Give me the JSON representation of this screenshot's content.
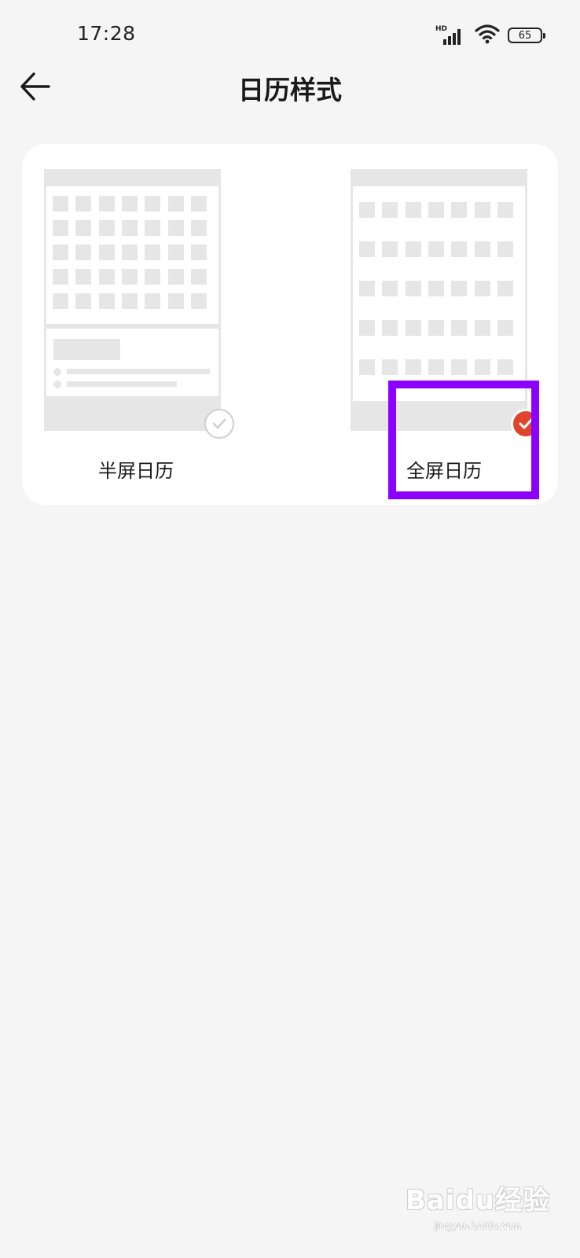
{
  "status_bar": {
    "time": "17:28",
    "network_label": "HD",
    "battery_level": "65"
  },
  "header": {
    "title": "日历样式",
    "back_icon": "arrow-left-icon"
  },
  "options": [
    {
      "label": "半屏日历",
      "selected": false,
      "check_icon": "check-circle-outline-icon"
    },
    {
      "label": "全屏日历",
      "selected": true,
      "check_icon": "check-circle-filled-icon"
    }
  ],
  "colors": {
    "background": "#f5f5f5",
    "card": "#ffffff",
    "placeholder": "#e6e6e6",
    "accent": "#e0442a",
    "highlight": "#8b00ff"
  },
  "watermark": {
    "brand": "Baidu经验",
    "url": "jingyan.baidu.com"
  }
}
